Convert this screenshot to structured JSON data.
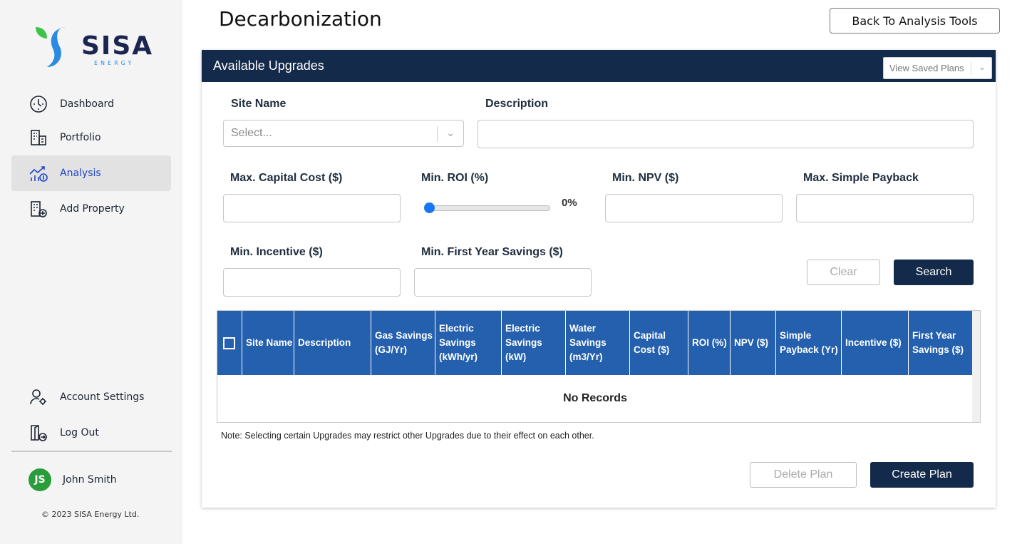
{
  "brand": {
    "name": "SISA",
    "sub": "ENERGY",
    "colors": {
      "navy": "#1a2550",
      "blue": "#2b8ae2",
      "green": "#3ec34a"
    }
  },
  "sidebar": {
    "items": [
      {
        "label": "Dashboard",
        "icon": "gauge-icon"
      },
      {
        "label": "Portfolio",
        "icon": "buildings-icon"
      },
      {
        "label": "Analysis",
        "icon": "chart-dollar-icon",
        "active": true
      },
      {
        "label": "Add Property",
        "icon": "building-add-icon"
      }
    ],
    "bottom_items": [
      {
        "label": "Account Settings",
        "icon": "user-gear-icon"
      },
      {
        "label": "Log Out",
        "icon": "logout-icon"
      }
    ],
    "user": {
      "initials": "JS",
      "name": "John Smith"
    },
    "copyright": "© 2023 SISA Energy Ltd."
  },
  "header": {
    "title": "Decarbonization",
    "back_label": "Back To Analysis Tools"
  },
  "card": {
    "title": "Available Upgrades",
    "saved_plans_placeholder": "View Saved Plans"
  },
  "form": {
    "site_name_label": "Site Name",
    "site_name_placeholder": "Select...",
    "description_label": "Description",
    "description_value": "",
    "max_capital_label": "Max. Capital Cost ($)",
    "min_roi_label": "Min. ROI (%)",
    "min_roi_value": "0%",
    "min_roi_level": 0,
    "min_npv_label": "Min. NPV ($)",
    "max_payback_label": "Max. Simple Payback",
    "min_incentive_label": "Min. Incentive ($)",
    "min_first_year_label": "Min. First Year Savings ($)",
    "clear_label": "Clear",
    "search_label": "Search"
  },
  "table": {
    "columns": [
      "Site Name",
      "Description",
      "Gas Savings (GJ/Yr)",
      "Electric Savings (kWh/yr)",
      "Electric Savings (kW)",
      "Water Savings (m3/Yr)",
      "Capital Cost ($)",
      "ROI (%)",
      "NPV ($)",
      "Simple Payback (Yr)",
      "Incentive ($)",
      "First Year Savings ($)"
    ],
    "empty_text": "No Records"
  },
  "note": "Note: Selecting certain Upgrades may restrict other Upgrades due to their effect on each other.",
  "actions": {
    "delete_label": "Delete Plan",
    "create_label": "Create Plan"
  }
}
